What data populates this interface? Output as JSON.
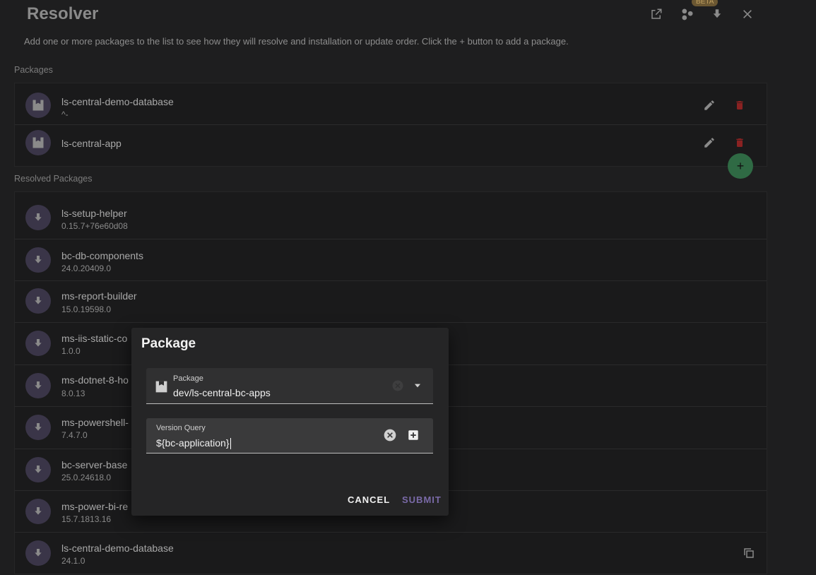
{
  "app": {
    "title": "Resolver",
    "description": "Add one or more packages to the list to see how they will resolve and installation or update order. Click the + button to add a package.",
    "beta_badge": "BETA"
  },
  "packages": {
    "label": "Packages",
    "items": [
      {
        "name": "ls-central-demo-database",
        "version": "^-"
      },
      {
        "name": "ls-central-app",
        "version": ""
      }
    ]
  },
  "resolved": {
    "label": "Resolved Packages",
    "items": [
      {
        "name": "ls-setup-helper",
        "version": "0.15.7+76e60d08"
      },
      {
        "name": "bc-db-components",
        "version": "24.0.20409.0"
      },
      {
        "name": "ms-report-builder",
        "version": "15.0.19598.0"
      },
      {
        "name": "ms-iis-static-co",
        "version": "1.0.0"
      },
      {
        "name": "ms-dotnet-8-ho",
        "version": "8.0.13"
      },
      {
        "name": "ms-powershell-",
        "version": "7.4.7.0"
      },
      {
        "name": "bc-server-base",
        "version": "25.0.24618.0"
      },
      {
        "name": "ms-power-bi-re",
        "version": "15.7.1813.16"
      },
      {
        "name": "ls-central-demo-database",
        "version": "24.1.0"
      }
    ]
  },
  "fab": {
    "label": "+"
  },
  "dialog": {
    "title": "Package",
    "package_field": {
      "label": "Package",
      "value": "dev/ls-central-bc-apps"
    },
    "version_field": {
      "label": "Version Query",
      "value": "${bc-application}"
    },
    "cancel_label": "CANCEL",
    "submit_label": "SUBMIT"
  },
  "colors": {
    "accent_purple": "#7a6aa8",
    "fab_green": "#2f6a44",
    "delete_red": "#8a2222",
    "beta_badge": "#6b5732"
  },
  "icons": [
    "open-in-new-icon",
    "hub-icon",
    "download-icon",
    "close-icon",
    "package-icon",
    "pencil-icon",
    "trash-icon",
    "plus-icon",
    "copy-icon",
    "clear-icon",
    "chevron-down-icon",
    "add-box-icon"
  ]
}
